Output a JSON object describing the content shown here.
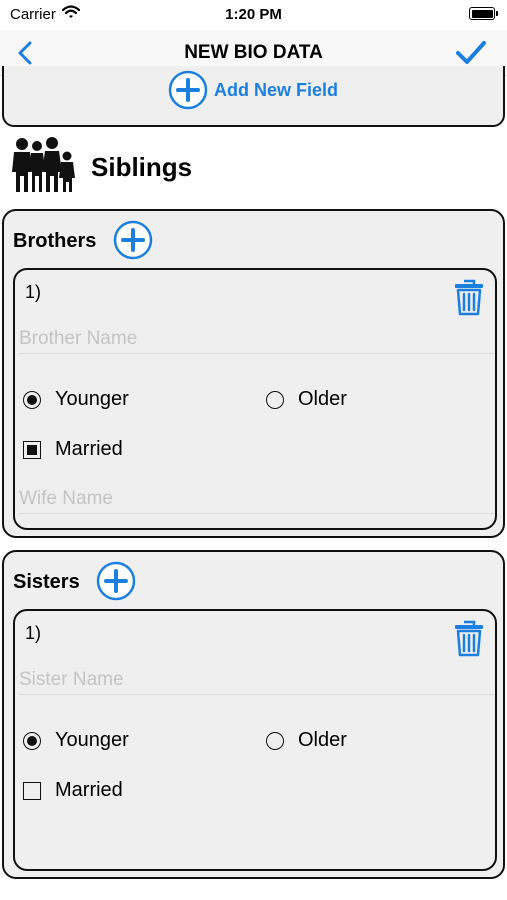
{
  "status_bar": {
    "carrier": "Carrier",
    "time": "1:20 PM"
  },
  "nav": {
    "title": "NEW BIO DATA",
    "back_icon": "chevron-left-icon",
    "done_icon": "checkmark-icon"
  },
  "previous_section": {
    "add_field_label": "Add New Field"
  },
  "siblings": {
    "title": "Siblings",
    "brothers": {
      "title": "Brothers",
      "entries": [
        {
          "index": "1)",
          "name_placeholder": "Brother Name",
          "younger_label": "Younger",
          "older_label": "Older",
          "younger_selected": true,
          "older_selected": false,
          "married_label": "Married",
          "married_checked": true,
          "spouse_placeholder": "Wife Name"
        }
      ]
    },
    "sisters": {
      "title": "Sisters",
      "entries": [
        {
          "index": "1)",
          "name_placeholder": "Sister Name",
          "younger_label": "Younger",
          "older_label": "Older",
          "younger_selected": true,
          "older_selected": false,
          "married_label": "Married",
          "married_checked": false
        }
      ]
    }
  },
  "colors": {
    "accent": "#1c7fe0",
    "card_bg": "#efefef",
    "border": "#111111",
    "placeholder": "#c4c4c4"
  }
}
